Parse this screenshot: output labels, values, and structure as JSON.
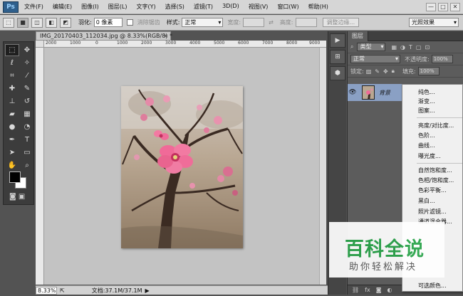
{
  "app": {
    "logo": "Ps",
    "menu": [
      "文件(F)",
      "编辑(E)",
      "图像(I)",
      "图层(L)",
      "文字(Y)",
      "选择(S)",
      "滤镜(T)",
      "3D(D)",
      "视图(V)",
      "窗口(W)",
      "帮助(H)"
    ],
    "window_controls": [
      "—",
      "□",
      "✕"
    ]
  },
  "options": {
    "feather_label": "羽化:",
    "feather_value": "0 像素",
    "antialias_label": "消除锯齿",
    "style_label": "样式:",
    "style_value": "正常",
    "width_label": "宽度:",
    "height_label": "高度:",
    "refine_edge": "调整边缘...",
    "preset": "光照效果"
  },
  "document": {
    "tab_title": "IMG_20170403_112034.jpg @ 8.33%(RGB/8) *",
    "close": "×",
    "ruler_ticks": [
      "2000",
      "1000",
      "0",
      "1000",
      "2000",
      "3000",
      "4000",
      "5000",
      "6000",
      "7000",
      "8000",
      "9000"
    ]
  },
  "status": {
    "zoom": "8.33%",
    "doc_info": "文档:37.1M/37.1M",
    "arrow": "▶"
  },
  "layers_panel": {
    "tab": "图层",
    "kind_filter": "类型",
    "blend_mode": "正常",
    "opacity_label": "不透明度:",
    "opacity_value": "100%",
    "lock_label": "锁定:",
    "fill_label": "填充:",
    "fill_value": "100%",
    "layer_name": "背景"
  },
  "adjust_menu": {
    "items": [
      "纯色...",
      "渐变...",
      "图案...",
      "亮度/对比度...",
      "色阶...",
      "曲线...",
      "曝光度...",
      "自然饱和度...",
      "色相/饱和度...",
      "色彩平衡...",
      "黑白...",
      "照片滤镜...",
      "通道混合器...",
      "可选颜色..."
    ]
  },
  "watermark": {
    "title": "百科全说",
    "subtitle": "助你轻松解决"
  }
}
